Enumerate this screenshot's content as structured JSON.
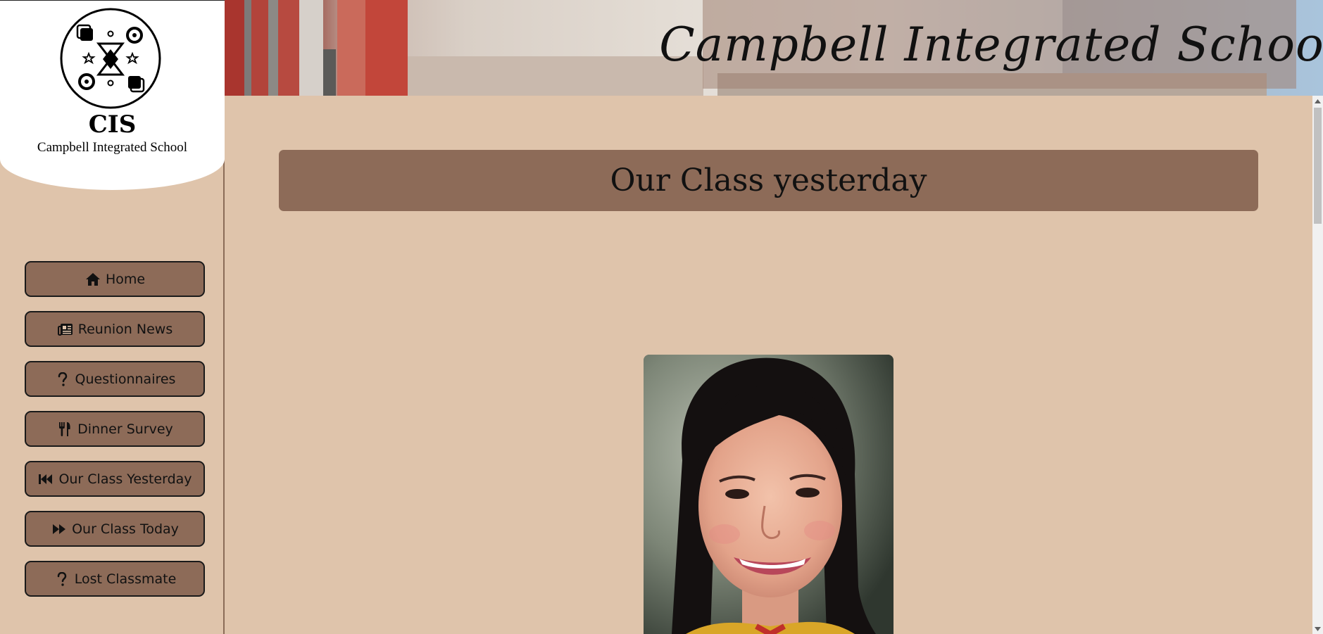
{
  "logo": {
    "abbreviation": "CIS",
    "name": "Campbell Integrated School",
    "emblem_icon": "school-emblem-icon"
  },
  "banner": {
    "title": "Campbell Integrated School"
  },
  "nav": {
    "items": [
      {
        "label": "Home",
        "icon": "home-icon"
      },
      {
        "label": "Reunion News",
        "icon": "newspaper-icon"
      },
      {
        "label": "Questionnaires",
        "icon": "question-icon"
      },
      {
        "label": "Dinner Survey",
        "icon": "utensils-icon"
      },
      {
        "label": "Our Class Yesterday",
        "icon": "fast-backward-icon"
      },
      {
        "label": "Our Class Today",
        "icon": "fast-forward-icon"
      },
      {
        "label": "Lost Classmate",
        "icon": "question-icon"
      }
    ]
  },
  "main": {
    "heading": "Our Class yesterday",
    "photo_subject": "student-portrait"
  },
  "colors": {
    "page_background": "#dfc4ab",
    "button_background": "#8d6b58",
    "heading_background": "#8d6b58",
    "logo_panel": "#ffffff"
  }
}
